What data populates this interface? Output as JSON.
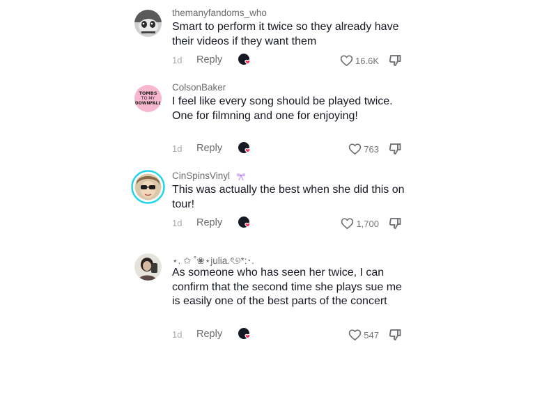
{
  "colors": {
    "username": "#6b6b70",
    "text": "#161823",
    "muted": "#a8a8ad",
    "creator_heart": "#fe2c55",
    "story_ring": "#20d5ec"
  },
  "comments": [
    {
      "username": "themanyfandoms_who",
      "text": "Smart to perform it twice so they already have their videos if they want them",
      "time": "1d",
      "reply_label": "Reply",
      "likes": "16.6K",
      "avatar_icon": "stitch-avatar"
    },
    {
      "username": "ColsonBaker",
      "text": "I feel like every song should be played twice. One for filmning and one for enjoying!",
      "time": "1d",
      "reply_label": "Reply",
      "likes": "763",
      "avatar_icon": "pink-text-avatar"
    },
    {
      "username": "CinSpinsVinyl",
      "text": "This was actually the best when she did this on tour!",
      "time": "1d",
      "reply_label": "Reply",
      "likes": "1,700",
      "avatar_icon": "sunglasses-avatar",
      "badge_icon": "ribbon-emoji"
    },
    {
      "username": "⋆. ✩ ˚❀⋆julia.ৎ୭*:･.",
      "text": "As someone who has seen her twice, I can confirm that the second time she plays sue me is easily one of the best parts of the concert",
      "time": "1d",
      "reply_label": "Reply",
      "likes": "547",
      "avatar_icon": "selfie-avatar"
    }
  ]
}
